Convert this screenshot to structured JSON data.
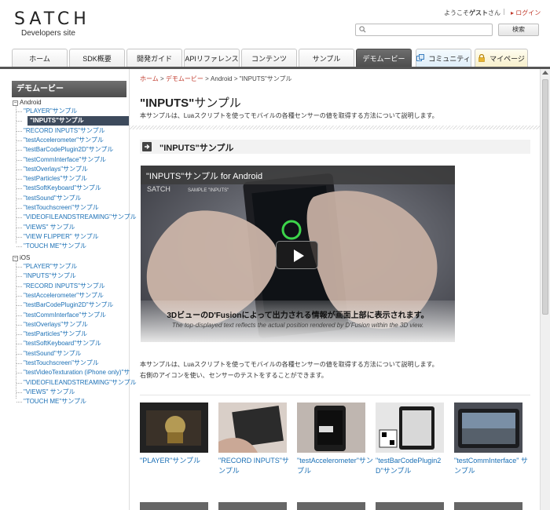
{
  "header": {
    "logo": "SATCH",
    "logo_sub": "Developers site",
    "welcome_prefix": "ようこそ",
    "welcome_user": "ゲスト",
    "welcome_suffix": "さん",
    "separator": "|",
    "login": "ログイン",
    "search_placeholder": "",
    "search_button": "検索"
  },
  "nav": {
    "tabs": [
      {
        "label": "ホーム"
      },
      {
        "label": "SDK概要"
      },
      {
        "label": "開発ガイド"
      },
      {
        "label": "APIリファレンス"
      },
      {
        "label": "コンテンツ"
      },
      {
        "label": "サンプル"
      },
      {
        "label": "デモムービー",
        "active": true
      },
      {
        "label": "コミュニティ",
        "icon": "window-icon"
      },
      {
        "label": "マイページ",
        "icon": "lock-icon"
      }
    ]
  },
  "sidebar": {
    "heading": "デモムービー",
    "android": {
      "label": "Android",
      "items": [
        "\"PLAYER\"サンプル",
        "\"INPUTS\"サンプル",
        "\"RECORD INPUTS\"サンプル",
        "\"testAccelerometer\"サンプル",
        "\"testBarCodePlugin2D\"サンプル",
        "\"testCommInterface\"サンプル",
        "\"testOverlays\"サンプル",
        "\"testParticles\"サンプル",
        "\"testSoftKeyboard\"サンプル",
        "\"testSound\"サンプル",
        "\"testTouchscreen\"サンプル",
        "\"VIDEOFILEANDSTREAMING\"サンプル",
        "\"VIEWS\" サンプル",
        "\"VIEW FLIPPER\" サンプル",
        "\"TOUCH ME\"サンプル"
      ]
    },
    "ios": {
      "label": "iOS",
      "items": [
        "\"PLAYER\"サンプル",
        "\"INPUTS\"サンプル",
        "\"RECORD INPUTS\"サンプル",
        "\"testAccelerometer\"サンプル",
        "\"testBarCodePlugin2D\"サンプル",
        "\"testCommInterface\"サンプル",
        "\"testOverlays\"サンプル",
        "\"testParticles\"サンプル",
        "\"testSoftKeyboard\"サンプル",
        "\"testSound\"サンプル",
        "\"testTouchscreen\"サンプル",
        "\"testVideoTexturation (iPhone only)\"サ",
        "\"VIDEOFILEANDSTREAMING\"サンプル",
        "\"VIEWS\" サンプル",
        "\"TOUCH ME\"サンプル"
      ]
    }
  },
  "breadcrumb": {
    "home": "ホーム",
    "sep": ">",
    "demo": "デモムービー",
    "platform": "Android",
    "current": "\"INPUTS\"サンプル"
  },
  "main": {
    "title_bold": "\"INPUTS\"",
    "title_rest": "サンプル",
    "description": "本サンプルは、Luaスクリプトを使ってモバイルの各種センサーの値を取得する方法について説明します。",
    "section_title": "\"INPUTS\"サンプル",
    "video": {
      "title": "\"INPUTS\"サンプル for Android",
      "caption_jp": "3DビューのD'Fusionによって出力される情報が画面上部に表示されます。",
      "caption_en": "The top-displayed text reflects the actual position rendered by D'Fusion within the 3D view."
    },
    "body_line1": "本サンプルは、Luaスクリプトを使ってモバイルの各種センサーの値を取得する方法について説明します。",
    "body_line2": "右側のアイコンを使い、センサーのテストをすることができます。",
    "thumbnails": [
      {
        "label": "\"PLAYER\"サンプル"
      },
      {
        "label": "\"RECORD INPUTS\"サンプル"
      },
      {
        "label": "\"testAccelerometer\"サンプル"
      },
      {
        "label": "\"testBarCodePlugin2D\"サンプル"
      },
      {
        "label": "\"testCommInterface\" サンプル"
      }
    ]
  },
  "colors": {
    "link": "#1a6fb5",
    "accent_red": "#c0392b",
    "nav_active": "#4b4b4b"
  }
}
